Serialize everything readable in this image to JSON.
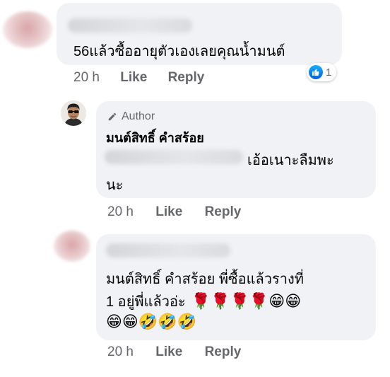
{
  "comments": [
    {
      "text": "56แล้วซื้ออายุตัวเองเลยคุณน้ำมนต์",
      "time": "20 h",
      "like_label": "Like",
      "reply_label": "Reply",
      "reaction_count": "1",
      "reaction_icon": "like-icon"
    },
    {
      "badge": "Author",
      "name": "มนต์สิทธิ์ คำสร้อย",
      "text_line1": "เอ้อเนาะลืมพะ",
      "text_line2": "นะ",
      "time": "20 h",
      "like_label": "Like",
      "reply_label": "Reply"
    },
    {
      "text_line1": "มนต์สิทธิ์ คำสร้อย   พี่ซื้อแล้วรางที่",
      "text_line2": "1  อยู่พี่แล้วอ่ะ",
      "emojis_line2": "🌹🌹🌹🌹😁😁",
      "emojis_line3": "😁😁🤣🤣🤣",
      "time": "20 h",
      "like_label": "Like",
      "reply_label": "Reply"
    }
  ],
  "colors": {
    "bubble": "#f0f2f5",
    "meta": "#65676b",
    "like_blue": "#1877f2"
  }
}
